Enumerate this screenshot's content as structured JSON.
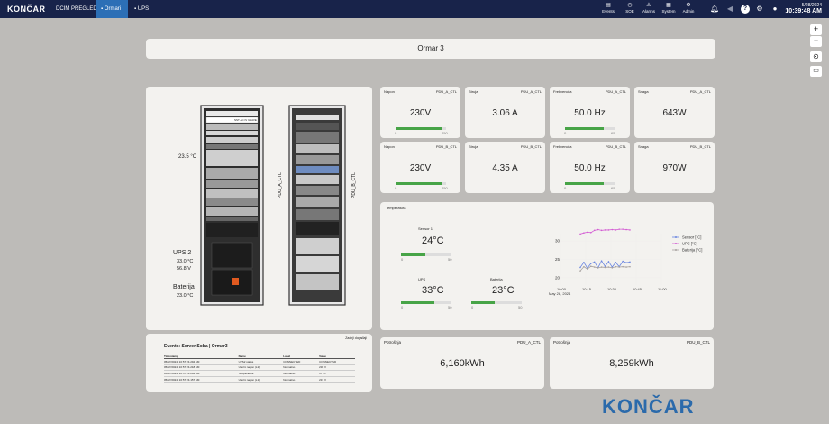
{
  "topbar": {
    "logo": "KONČAR",
    "nav": [
      "DCIM PREGLED",
      "Ormari",
      "UPS"
    ],
    "icons": [
      {
        "name": "events",
        "label": "Events"
      },
      {
        "name": "soe",
        "label": "SOE"
      },
      {
        "name": "alarms",
        "label": "Alarms"
      },
      {
        "name": "system",
        "label": "System"
      },
      {
        "name": "admin",
        "label": "Admin"
      }
    ],
    "date": "5/28/2024",
    "time": "10:39:48 AM"
  },
  "title": "Ormar 3",
  "side": {
    "zoom_in": "+",
    "zoom_out": "−"
  },
  "rack": {
    "label_top": "SST AC IV GLAVE",
    "rack_temp": "23.5 °C",
    "ups_title": "UPS 2",
    "ups_t1": "33.0 °C",
    "ups_t2": "56.8 V",
    "bat_title": "Baterija",
    "bat_temp": "23.0 °C",
    "pdu_a": "PDU_A_CTL",
    "pdu_b": "PDU_B_CTL"
  },
  "cards_row1": [
    {
      "label": "Napon",
      "device": "PDU_A_CTL",
      "value": "230V",
      "min": "0",
      "max": "250",
      "fraction": 0.92
    },
    {
      "label": "Struja",
      "device": "PDU_A_CTL",
      "value": "3.06 A"
    },
    {
      "label": "Frekvencija",
      "device": "PDU_A_CTL",
      "value": "50.0 Hz",
      "min": "0",
      "max": "65",
      "fraction": 0.77
    },
    {
      "label": "Snaga",
      "device": "PDU_A_CTL",
      "value": "643W"
    }
  ],
  "cards_row2": [
    {
      "label": "Napon",
      "device": "PDU_B_CTL",
      "value": "230V",
      "min": "0",
      "max": "250",
      "fraction": 0.92
    },
    {
      "label": "Struja",
      "device": "PDU_B_CTL",
      "value": "4.35 A"
    },
    {
      "label": "Frekvencija",
      "device": "PDU_B_CTL",
      "value": "50.0 Hz",
      "min": "0",
      "max": "65",
      "fraction": 0.77
    },
    {
      "label": "Snaga",
      "device": "PDU_B_CTL",
      "value": "970W"
    }
  ],
  "temperatura": {
    "title": "Temperatura",
    "sensor1": {
      "label": "Sensor 1",
      "value": "24°C",
      "min": "0",
      "max": "50",
      "fraction": 0.48
    },
    "ups": {
      "label": "UPS",
      "value": "33°C",
      "min": "0",
      "max": "50",
      "fraction": 0.66
    },
    "baterija": {
      "label": "Baterija",
      "value": "23°C",
      "min": "0",
      "max": "50",
      "fraction": 0.46
    }
  },
  "chart_data": {
    "type": "line",
    "x_ticks": [
      "10:00\nMay 28, 2024",
      "10:15",
      "10:30",
      "10:45",
      "11:00"
    ],
    "y_ticks": [
      "20",
      "25",
      "30"
    ],
    "ylim": [
      18,
      32
    ],
    "series": [
      {
        "name": "Sensor [°C]",
        "color": "#6b86e0",
        "values": [
          22.8,
          24.2,
          22.6,
          23.9,
          24.3,
          22.7,
          24.6,
          23.1,
          24.4,
          22.9,
          24.2,
          23.0,
          24.5,
          24.1,
          24.3
        ]
      },
      {
        "name": "UPS [°C]",
        "color": "#d35cd3",
        "values": [
          31.9,
          32.2,
          32.4,
          32.3,
          32.9,
          33.1,
          32.9,
          33.0,
          33.0,
          33.1,
          33.0,
          33.2,
          33.2,
          33.1,
          33.0
        ]
      },
      {
        "name": "Baterija [°C]",
        "color": "#a8a2a0",
        "values": [
          21.9,
          23.0,
          22.4,
          23.1,
          22.9,
          22.7,
          22.9,
          22.8,
          22.9,
          22.7,
          23.0,
          22.9,
          23.0,
          22.9,
          23.0
        ]
      }
    ]
  },
  "potrosnja": [
    {
      "label": "Potrošnja",
      "device": "PDU_A_CTL",
      "value": "6,160kWh"
    },
    {
      "label": "Potrošnja",
      "device": "PDU_B_CTL",
      "value": "8,259kWh"
    }
  ],
  "events": {
    "title": "Events: Server Soba | Ormar3",
    "link": "Zadnji događaji",
    "columns": [
      "Timestamp",
      "Name",
      "Label",
      "Value"
    ],
    "rows": [
      [
        "05/27/2024, 10:57:24.294 AM",
        "UPS2 status",
        "CONNECTED",
        "CONNECTED"
      ],
      [
        "05/27/2024, 10:57:24.218 AM",
        "Ulazni napon (L2)",
        "Normalno",
        "230 V"
      ],
      [
        "05/27/2024, 10:57:24.204 AM",
        "Temperature",
        "Normalno",
        "17 °C"
      ],
      [
        "05/27/2024, 10:57:24.157 AM",
        "Ulazni napon (L1)",
        "Normalno",
        "231 V"
      ]
    ]
  },
  "bottom_logo": "KONČAR"
}
